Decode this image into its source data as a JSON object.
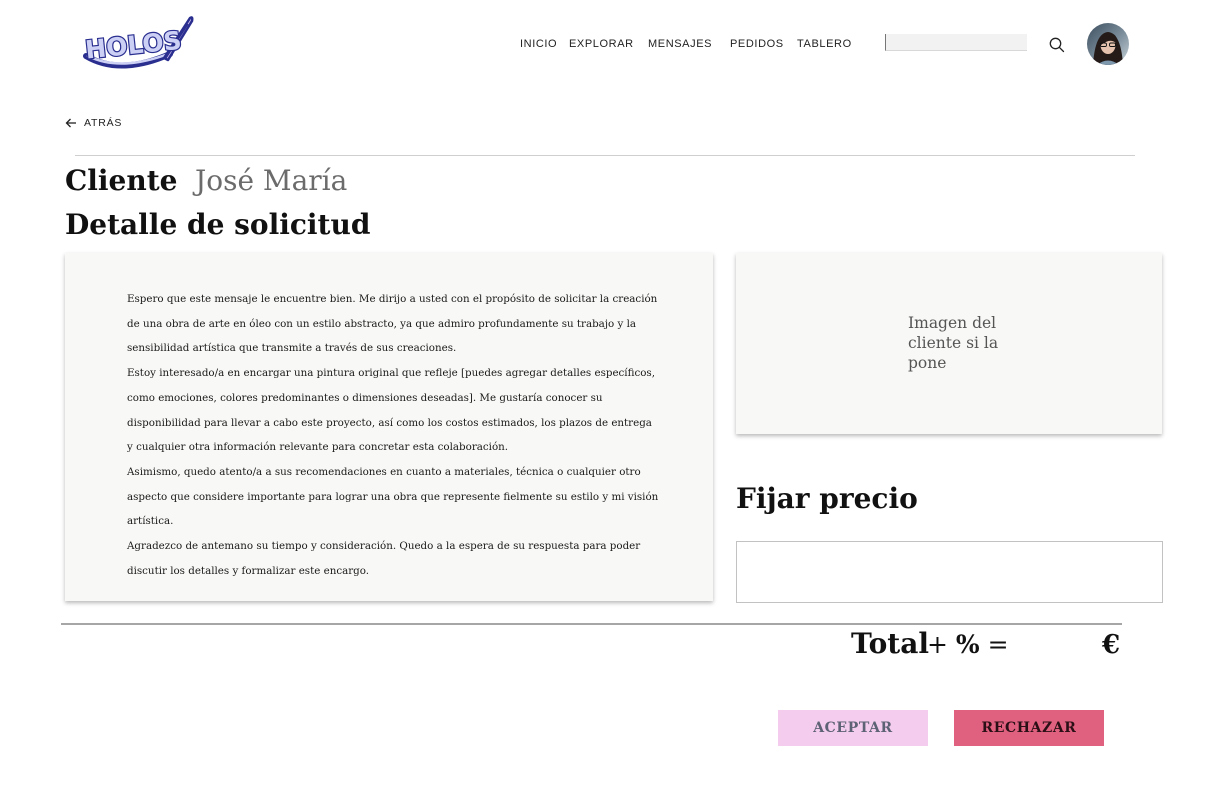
{
  "header": {
    "logo_text": "HOLOS",
    "nav": [
      "INICIO",
      "EXPLORAR",
      "MENSAJES",
      "PEDIDOS",
      "TABLERO"
    ],
    "search": {
      "value": "",
      "placeholder": ""
    }
  },
  "back": {
    "label": "ATRÁS"
  },
  "client": {
    "label": "Cliente",
    "name": "José María"
  },
  "request": {
    "title": "Detalle de solicitud",
    "paragraphs": [
      "Espero que este mensaje le encuentre bien. Me dirijo a usted con el propósito de solicitar la creación de una obra de arte en óleo con un estilo abstracto, ya que admiro profundamente su trabajo y la sensibilidad artística que transmite a través de sus creaciones.",
      "Estoy interesado/a en encargar una pintura original que refleje [puedes agregar detalles específicos, como emociones, colores predominantes o dimensiones deseadas]. Me gustaría conocer su disponibilidad para llevar a cabo este proyecto, así como los costos estimados, los plazos de entrega y cualquier otra información relevante para concretar esta colaboración.",
      "Asimismo, quedo atento/a a sus recomendaciones en cuanto a materiales, técnica o cualquier otro aspecto que considere importante para lograr una obra que represente fielmente su estilo y mi visión artística.",
      "Agradezco de antemano su tiempo y consideración. Quedo a la espera de su respuesta para poder discutir los detalles y formalizar este encargo."
    ]
  },
  "client_image": {
    "placeholder": "Imagen del cliente si la pone"
  },
  "price": {
    "title": "Fijar precio",
    "value": "",
    "placeholder": ""
  },
  "total": {
    "label": "Total",
    "plus": "+",
    "percent": "%",
    "equals": "=",
    "currency": "€"
  },
  "actions": {
    "accept": "ACEPTAR",
    "reject": "RECHAZAR"
  },
  "colors": {
    "accept_bg": "#f4ccee",
    "reject_bg": "#e0617f",
    "logo_blue": "#2a2f8f",
    "logo_light": "#cdd0f5"
  }
}
